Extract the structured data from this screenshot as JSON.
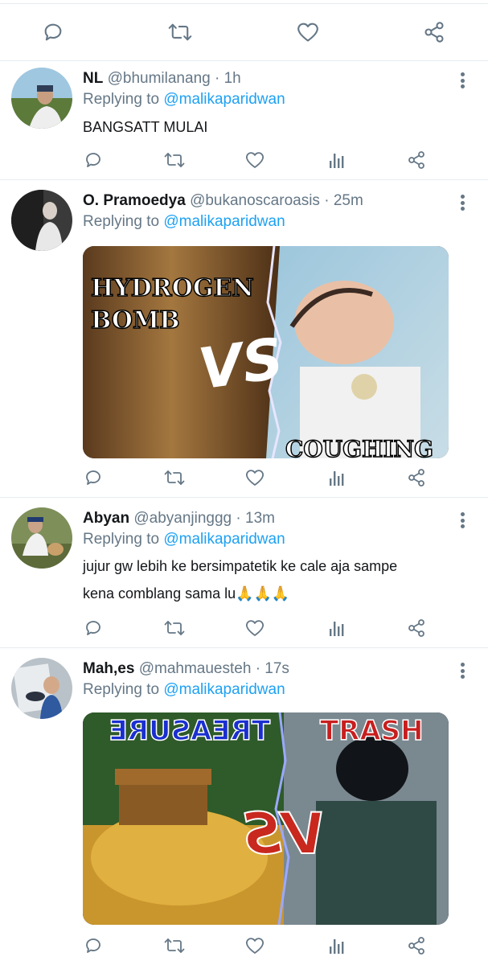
{
  "tweets": [
    {
      "name": "NL",
      "handle": "@bhumilanang",
      "sep": "·",
      "time": "1h",
      "replying_prefix": "Replying to",
      "replying_to": "@malikaparidwan",
      "text_lines": [
        "BANGSATT MULAI"
      ]
    },
    {
      "name": "O. Pramoedya",
      "handle": "@bukanoscaroasis",
      "sep": "·",
      "time": "25m",
      "replying_prefix": "Replying to",
      "replying_to": "@malikaparidwan",
      "media": {
        "left_label_1": "HYDROGEN",
        "left_label_2": "BOMB",
        "vs": "VS",
        "right_label": "COUGHING"
      }
    },
    {
      "name": "Abyan",
      "handle": "@abyanjinggg",
      "sep": "·",
      "time": "13m",
      "replying_prefix": "Replying to",
      "replying_to": "@malikaparidwan",
      "text_lines": [
        "jujur gw lebih ke bersimpatetik ke cale aja sampe",
        "kena comblang sama lu"
      ],
      "emoji": "🙏🙏🙏"
    },
    {
      "name": "Mah,es",
      "handle": "@mahmauesteh",
      "sep": "·",
      "time": "17s",
      "replying_prefix": "Replying to",
      "replying_to": "@malikaparidwan",
      "media": {
        "left_label": "TREASURE",
        "right_label": "TRASH",
        "vs": "VS"
      }
    }
  ],
  "colors": {
    "text_primary": "#14171a",
    "text_secondary": "#657786",
    "link": "#1da1f2",
    "divider": "#e6ecf0"
  },
  "icons": [
    "reply-icon",
    "retweet-icon",
    "like-icon",
    "analytics-icon",
    "share-icon",
    "more-icon"
  ]
}
